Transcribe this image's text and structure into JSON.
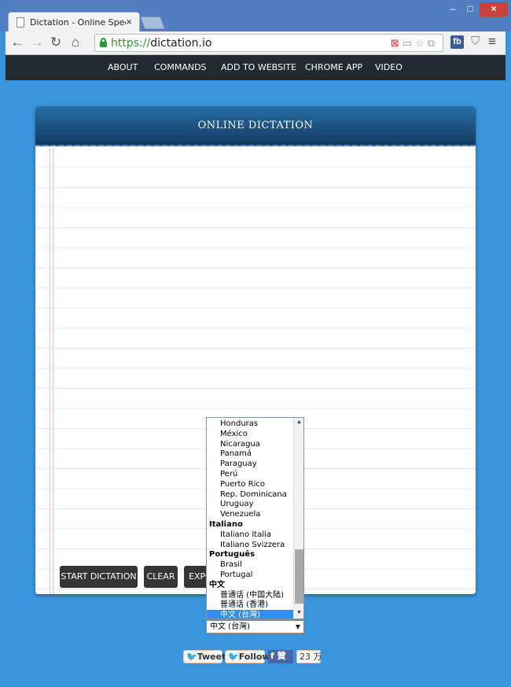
{
  "browser": {
    "tab_title": "Dictation - Online Speec",
    "tab_close": "×",
    "url_scheme": "https://",
    "url_host": "dictation.io",
    "win_min": "–",
    "win_max": "□",
    "win_close": "×",
    "ext_fb": "fb"
  },
  "nav": {
    "items": [
      "ABOUT",
      "COMMANDS",
      "ADD TO WEBSITE",
      "CHROME APP",
      "VIDEO"
    ]
  },
  "panel": {
    "title": "ONLINE DICTATION"
  },
  "buttons": {
    "start": "START DICTATION",
    "clear": "CLEAR",
    "export": "EXPO"
  },
  "language_list": {
    "items": [
      {
        "label": "Honduras",
        "kind": "opt"
      },
      {
        "label": "México",
        "kind": "opt"
      },
      {
        "label": "Nicaragua",
        "kind": "opt"
      },
      {
        "label": "Panamá",
        "kind": "opt"
      },
      {
        "label": "Paraguay",
        "kind": "opt"
      },
      {
        "label": "Perú",
        "kind": "opt"
      },
      {
        "label": "Puerto Rico",
        "kind": "opt"
      },
      {
        "label": "Rep. Dominicana",
        "kind": "opt"
      },
      {
        "label": "Uruguay",
        "kind": "opt"
      },
      {
        "label": "Venezuela",
        "kind": "opt"
      },
      {
        "label": "Italiano",
        "kind": "grp"
      },
      {
        "label": "Italiano Italia",
        "kind": "opt"
      },
      {
        "label": "Italiano Svizzera",
        "kind": "opt"
      },
      {
        "label": "Português",
        "kind": "grp"
      },
      {
        "label": "Brasil",
        "kind": "opt"
      },
      {
        "label": "Portugal",
        "kind": "opt"
      },
      {
        "label": "中文",
        "kind": "grp"
      },
      {
        "label": "普通话 (中国大陆)",
        "kind": "opt"
      },
      {
        "label": "普通话 (香港)",
        "kind": "opt"
      },
      {
        "label": "中文 (台灣)",
        "kind": "opt",
        "selected": true
      }
    ],
    "selected_value": "中文 (台灣)"
  },
  "social": {
    "tweet": "Tweet",
    "follow": "Follow",
    "fb_like": "贊",
    "fb_count": "23 万"
  },
  "colors": {
    "page_bg": "#3a94dc",
    "nav_bg": "#22292f",
    "selection": "#2f8ff0"
  }
}
